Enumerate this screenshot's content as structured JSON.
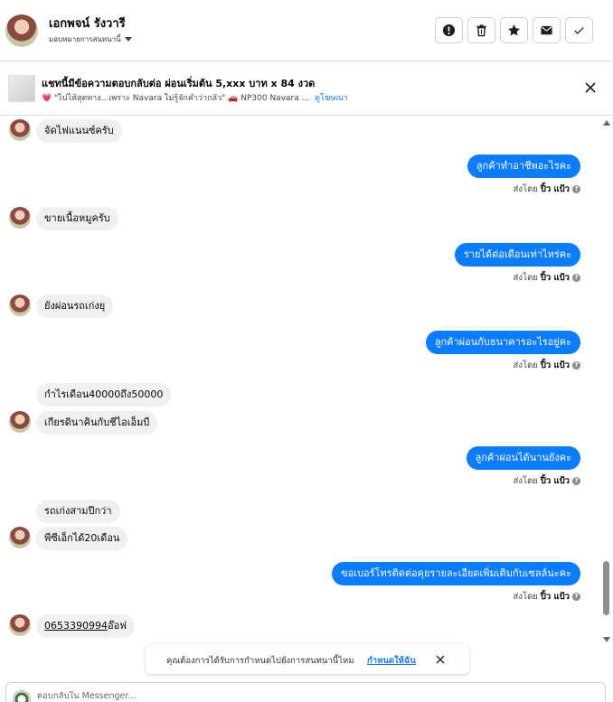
{
  "header": {
    "name": "เอกพจน์ รังวารี",
    "subtitle": "มอบหมายการสนทนานี้",
    "buttons": [
      "mark-important",
      "delete",
      "star",
      "mail",
      "done"
    ]
  },
  "ad": {
    "title": "แชทนี้มีข้อความตอบกลับต่อ ผ่อนเริ่มต้น 5,xxx บาท x 84 งวด",
    "line": "💗 \"ไปไห้สุดทาง...เพราะ Navara ไม่รู้จักคำว่ากลัว\" 🚗 NP300 Navara ...",
    "link": "ดูโฆษณา"
  },
  "sent_by_prefix": "ส่งโดย",
  "sender_name": "ปิ้ว แป้ว",
  "info_glyph": "?",
  "messages": [
    {
      "text": "จัดไฟแนนซ์ครับ"
    },
    {
      "text": "ลูกค้าทำอาชีพอะไรคะ"
    },
    {
      "text": "ขายเนื้อหมูครับ"
    },
    {
      "text": "รายได้ต่อเดือนเท่าไหร่คะ"
    },
    {
      "text": "ยังผ่อนรถเก่งยุ"
    },
    {
      "text": "ลูกค้าผ่อนกับธนาคารอะไรอยู่คะ"
    },
    {
      "text": "กำไรเดือน40000ถึง50000"
    },
    {
      "text": "เกียรดินาคินกับชีไอเอ็มบี"
    },
    {
      "text": "ลูกค้าผ่อนได้นานยังคะ"
    },
    {
      "text": "รถเก่งสามปีกว่า"
    },
    {
      "text": "พีซีเอ็กได้20เดือน"
    },
    {
      "text": "ขอเบอร์โทรติดต่อคุยรายละเอียดเพิ่มเติมกับเซลล์นะคะ"
    },
    {
      "phone": "0653390994",
      "suffix": "อ๊อฟ"
    }
  ],
  "banner": {
    "text": "คุณต้องการได้รับการกำหนดไปยังการสนทนานี้ไหม",
    "action": "กำหนดให้ฉัน"
  },
  "composer": {
    "placeholder": "ตอบกลับใน Messenger..."
  },
  "colors": {
    "outgoing_bubble": "#0a7cff",
    "incoming_bubble": "#f0f0f0",
    "link": "#1877f2"
  }
}
